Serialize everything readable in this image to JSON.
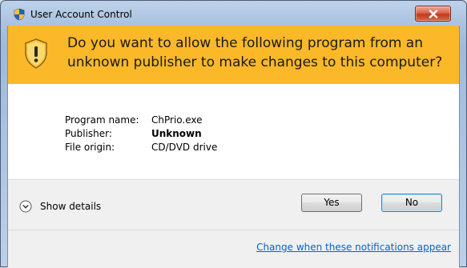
{
  "window": {
    "title": "User Account Control",
    "title_icon": "uac-shield-icon",
    "close_icon": "close-icon"
  },
  "banner": {
    "icon": "warning-shield-icon",
    "headline": "Do you want to allow the following program from an unknown publisher to make changes to this computer?",
    "color": "#fbb829"
  },
  "details": {
    "rows": [
      {
        "label": "Program name:",
        "value": "ChPrio.exe",
        "bold": false
      },
      {
        "label": "Publisher:",
        "value": "Unknown",
        "bold": true
      },
      {
        "label": "File origin:",
        "value": "CD/DVD drive",
        "bold": false
      }
    ]
  },
  "footer": {
    "show_details_label": "Show details",
    "show_details_icon": "chevron-down-circle-icon",
    "yes_label": "Yes",
    "no_label": "No",
    "link_label": "Change when these notifications appear",
    "link_color": "#0066cc"
  }
}
